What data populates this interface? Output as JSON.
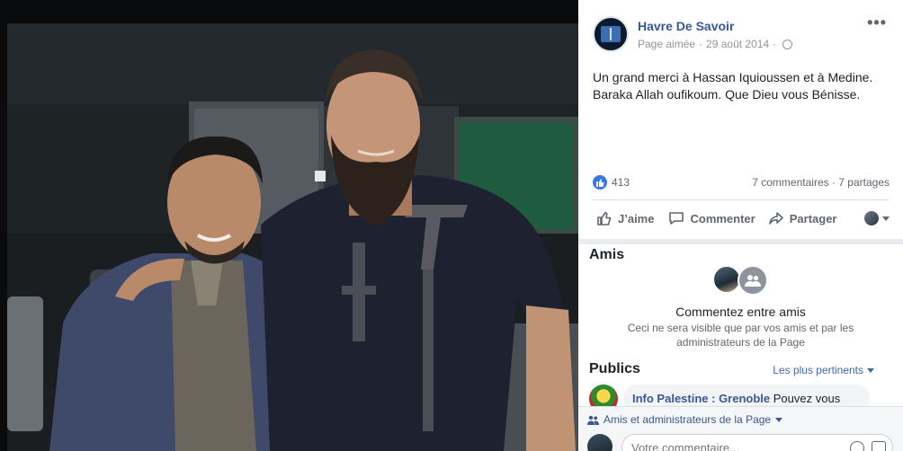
{
  "post": {
    "page_name": "Havre De Savoir",
    "liked_label": "Page aimée",
    "dot": "·",
    "date": "29 août 2014",
    "more_label": "•••",
    "text": "Un grand merci à Hassan Iquioussen et à Medine. Baraka Allah oufikoum. Que Dieu vous Bénisse.",
    "like_count": "413",
    "stats": "7 commentaires · 7 partages"
  },
  "actions": {
    "like": "J’aime",
    "comment": "Commenter",
    "share": "Partager"
  },
  "friends": {
    "title": "Amis",
    "prompt": "Commentez entre amis",
    "subtext": "Ceci ne sera visible que par vos amis et par les administrateurs de la Page"
  },
  "publics": {
    "title": "Publics",
    "sort_label": "Les plus pertinents",
    "first_comment": {
      "author": "Info Palestine : Grenoble",
      "text": "Pouvez vous"
    }
  },
  "composer": {
    "audience_filter": "Amis et administrateurs de la Page",
    "placeholder": "Votre commentaire..."
  },
  "icons": {
    "globe": "globe-icon",
    "like_badge": "thumbs-up-icon",
    "like": "thumbs-up-outline-icon",
    "comment": "speech-bubble-icon",
    "share": "share-arrow-icon",
    "people": "people-icon",
    "emoji": "smiley-icon",
    "sticker": "sticker-icon"
  },
  "colors": {
    "brand_link": "#385898",
    "accent_blue": "#3578e5",
    "secondary_text": "#606770"
  }
}
